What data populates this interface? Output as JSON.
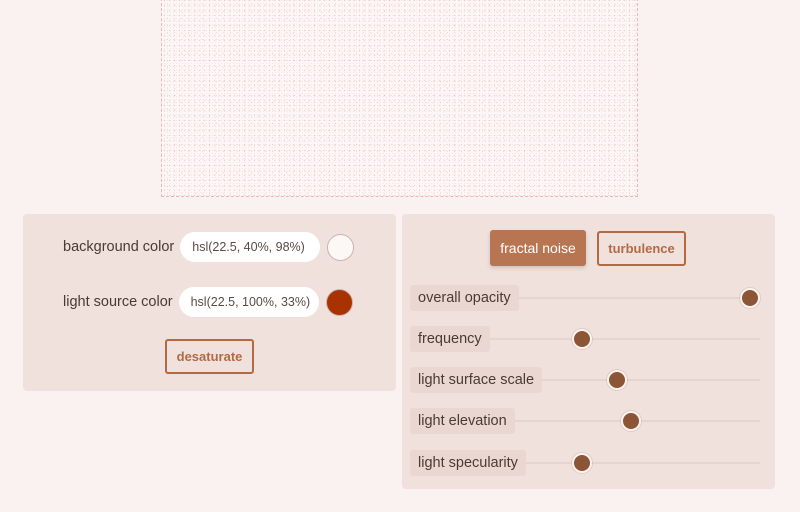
{
  "background_color": {
    "label": "background color",
    "value": "hsl(22.5, 40%, 98%)",
    "swatch": "#fcf8f6"
  },
  "light_source_color": {
    "label": "light source color",
    "value": "hsl(22.5, 100%, 33%)",
    "swatch": "#a83300"
  },
  "desaturate_label": "desaturate",
  "mode_buttons": {
    "fractal_noise": "fractal noise",
    "turbulence": "turbulence",
    "active": "fractal noise"
  },
  "sliders": [
    {
      "label": "overall opacity",
      "level": 0.97
    },
    {
      "label": "frequency",
      "level": 0.49
    },
    {
      "label": "light surface scale",
      "level": 0.59
    },
    {
      "label": "light elevation",
      "level": 0.63
    },
    {
      "label": "light specularity",
      "level": 0.49
    }
  ],
  "colors": {
    "accent": "#b36a43",
    "accent_fill": "#b77651",
    "thumb": "#8c5536",
    "panel": "#f0e1dd",
    "page": "#faf2f0"
  }
}
